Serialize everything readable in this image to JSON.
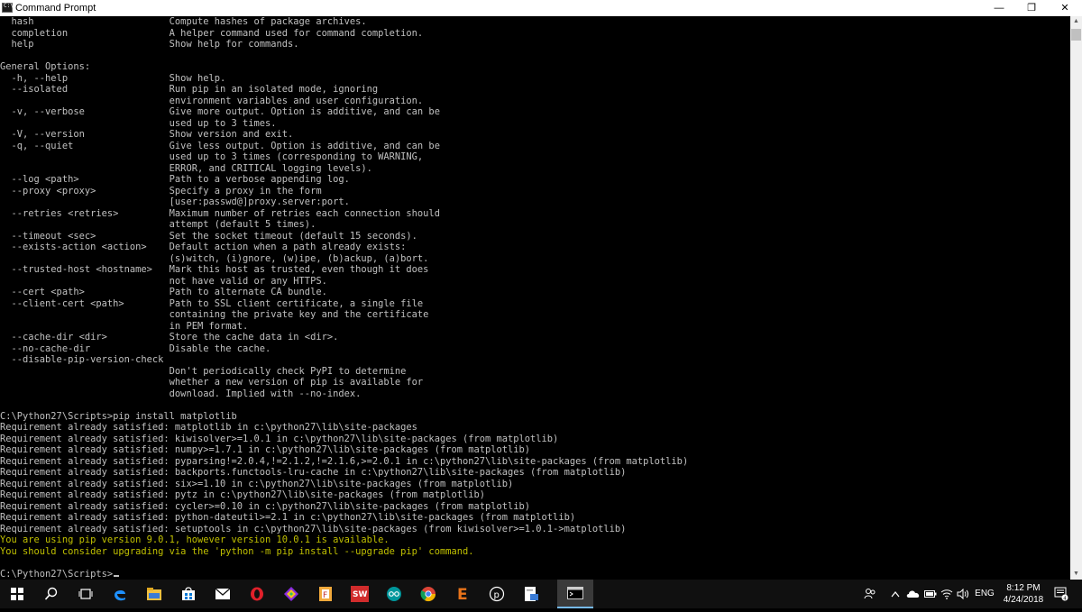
{
  "window": {
    "title": "Command Prompt",
    "minimize_glyph": "—",
    "maximize_glyph": "❐",
    "close_glyph": "✕"
  },
  "console": {
    "lines": [
      "  hash                        Compute hashes of package archives.",
      "  completion                  A helper command used for command completion.",
      "  help                        Show help for commands.",
      "",
      "General Options:",
      "  -h, --help                  Show help.",
      "  --isolated                  Run pip in an isolated mode, ignoring",
      "                              environment variables and user configuration.",
      "  -v, --verbose               Give more output. Option is additive, and can be",
      "                              used up to 3 times.",
      "  -V, --version               Show version and exit.",
      "  -q, --quiet                 Give less output. Option is additive, and can be",
      "                              used up to 3 times (corresponding to WARNING,",
      "                              ERROR, and CRITICAL logging levels).",
      "  --log <path>                Path to a verbose appending log.",
      "  --proxy <proxy>             Specify a proxy in the form",
      "                              [user:passwd@]proxy.server:port.",
      "  --retries <retries>         Maximum number of retries each connection should",
      "                              attempt (default 5 times).",
      "  --timeout <sec>             Set the socket timeout (default 15 seconds).",
      "  --exists-action <action>    Default action when a path already exists:",
      "                              (s)witch, (i)gnore, (w)ipe, (b)ackup, (a)bort.",
      "  --trusted-host <hostname>   Mark this host as trusted, even though it does",
      "                              not have valid or any HTTPS.",
      "  --cert <path>               Path to alternate CA bundle.",
      "  --client-cert <path>        Path to SSL client certificate, a single file",
      "                              containing the private key and the certificate",
      "                              in PEM format.",
      "  --cache-dir <dir>           Store the cache data in <dir>.",
      "  --no-cache-dir              Disable the cache.",
      "  --disable-pip-version-check",
      "                              Don't periodically check PyPI to determine",
      "                              whether a new version of pip is available for",
      "                              download. Implied with --no-index.",
      "",
      "C:\\Python27\\Scripts>pip install matplotlib",
      "Requirement already satisfied: matplotlib in c:\\python27\\lib\\site-packages",
      "Requirement already satisfied: kiwisolver>=1.0.1 in c:\\python27\\lib\\site-packages (from matplotlib)",
      "Requirement already satisfied: numpy>=1.7.1 in c:\\python27\\lib\\site-packages (from matplotlib)",
      "Requirement already satisfied: pyparsing!=2.0.4,!=2.1.2,!=2.1.6,>=2.0.1 in c:\\python27\\lib\\site-packages (from matplotlib)",
      "Requirement already satisfied: backports.functools-lru-cache in c:\\python27\\lib\\site-packages (from matplotlib)",
      "Requirement already satisfied: six>=1.10 in c:\\python27\\lib\\site-packages (from matplotlib)",
      "Requirement already satisfied: pytz in c:\\python27\\lib\\site-packages (from matplotlib)",
      "Requirement already satisfied: cycler>=0.10 in c:\\python27\\lib\\site-packages (from matplotlib)",
      "Requirement already satisfied: python-dateutil>=2.1 in c:\\python27\\lib\\site-packages (from matplotlib)",
      "Requirement already satisfied: setuptools in c:\\python27\\lib\\site-packages (from kiwisolver>=1.0.1->matplotlib)"
    ],
    "warning_lines": [
      "You are using pip version 9.0.1, however version 10.0.1 is available.",
      "You should consider upgrading via the 'python -m pip install --upgrade pip' command."
    ],
    "prompt": "C:\\Python27\\Scripts>",
    "text_color": "#c0c0c0",
    "warning_color": "#c0c000"
  },
  "taskbar": {
    "apps": [
      "windows-start-icon",
      "search-icon",
      "task-view-icon",
      "edge-browser-icon",
      "file-explorer-icon",
      "store-icon",
      "mail-icon",
      "opera-icon",
      "colorful-app-icon",
      "file-app-icon",
      "solidworks-icon",
      "arduino-icon",
      "chrome-icon",
      "e-app-icon",
      "circle-p-app-icon",
      "document-app-icon",
      "command-prompt-icon"
    ],
    "tray": {
      "language": "ENG",
      "time": "8:12 PM",
      "date": "4/24/2018",
      "notifications_count": "4"
    }
  }
}
